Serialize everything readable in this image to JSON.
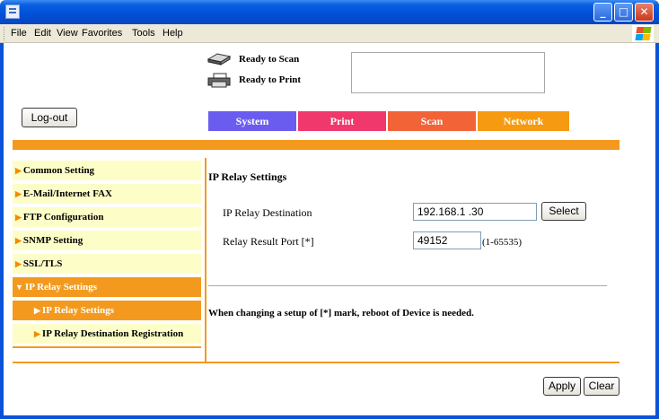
{
  "menu": [
    "File",
    "Edit",
    "View",
    "Favorites",
    "Tools",
    "Help"
  ],
  "status": {
    "scan": "Ready to Scan",
    "print": "Ready to Print"
  },
  "logout_label": "Log-out",
  "tabs": [
    {
      "label": "System",
      "color": "#6b5cf0"
    },
    {
      "label": "Print",
      "color": "#f0386c"
    },
    {
      "label": "Scan",
      "color": "#f26338"
    },
    {
      "label": "Network",
      "color": "#f69a12"
    }
  ],
  "sidenav": {
    "items": [
      {
        "label": "Common Setting"
      },
      {
        "label": "E-Mail/Internet FAX"
      },
      {
        "label": "FTP Configuration"
      },
      {
        "label": "SNMP Setting"
      },
      {
        "label": "SSL/TLS"
      },
      {
        "label": "IP Relay Settings"
      },
      {
        "label": "IP Relay Settings"
      },
      {
        "label": "IP Relay Destination Registration"
      }
    ]
  },
  "main": {
    "title": "IP Relay Settings",
    "destination_label": "IP Relay Destination",
    "destination_value": "192.168.1  .30",
    "select_label": "Select",
    "port_label": "Relay Result Port [*]",
    "port_value": "49152",
    "port_range": "(1-65535)",
    "note": "When changing a setup of [*] mark, reboot of Device is needed."
  },
  "footer": {
    "apply_label": "Apply",
    "clear_label": "Clear"
  },
  "colors": {
    "accent_orange": "#f39a1e",
    "nav_bg": "#fdfdc8",
    "titlebar_blue": "#0a52d8"
  }
}
